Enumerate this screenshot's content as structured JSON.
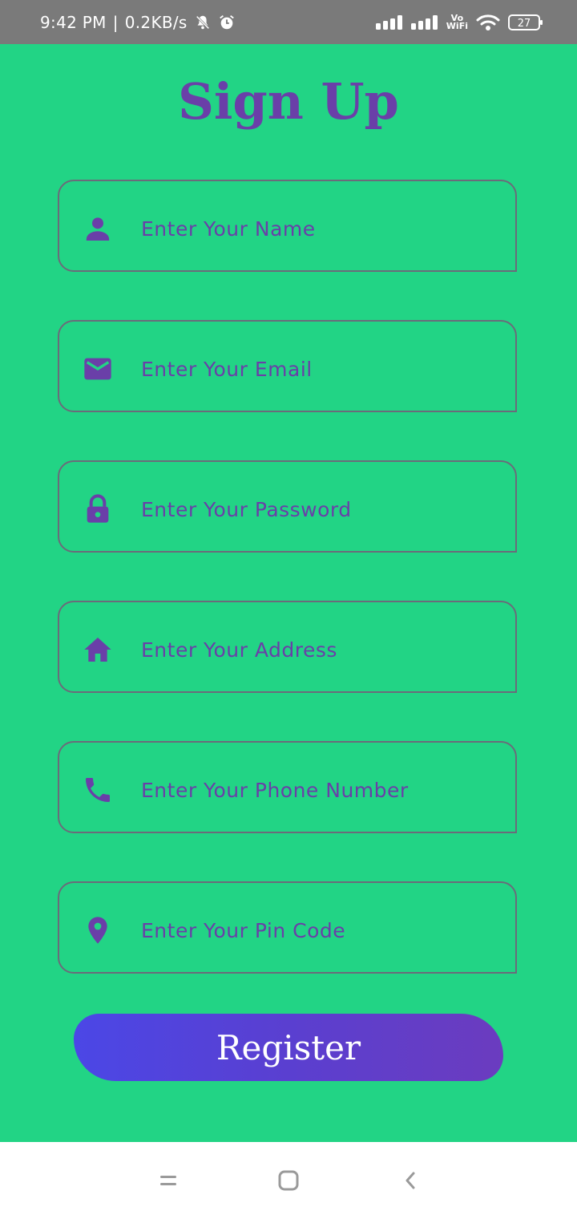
{
  "status_bar": {
    "time": "9:42 PM",
    "separator": "|",
    "network_speed": "0.2KB/s",
    "vowifi_top": "Vo",
    "vowifi_bottom": "WiFi",
    "battery": "27",
    "icons": [
      "mute-bell-icon",
      "alarm-icon",
      "signal-icon",
      "signal-icon",
      "wifi-icon",
      "battery-icon"
    ]
  },
  "form": {
    "title": "Sign Up",
    "fields": [
      {
        "icon": "person-icon",
        "placeholder": "Enter Your Name",
        "value": ""
      },
      {
        "icon": "mail-icon",
        "placeholder": "Enter Your Email",
        "value": ""
      },
      {
        "icon": "lock-icon",
        "placeholder": "Enter Your Password",
        "value": ""
      },
      {
        "icon": "home-icon",
        "placeholder": "Enter Your Address",
        "value": ""
      },
      {
        "icon": "phone-icon",
        "placeholder": "Enter Your Phone Number",
        "value": ""
      },
      {
        "icon": "location-pin-icon",
        "placeholder": "Enter Your Pin Code",
        "value": ""
      }
    ],
    "register_label": "Register"
  },
  "nav_bar": {
    "buttons": [
      "menu-icon",
      "home-square-icon",
      "back-icon"
    ]
  },
  "colors": {
    "background": "#22d485",
    "accent": "#6a3fa8",
    "status_bar": "#7a7a7a",
    "button_gradient_start": "#4b47e6",
    "button_gradient_end": "#6b3cbf"
  }
}
